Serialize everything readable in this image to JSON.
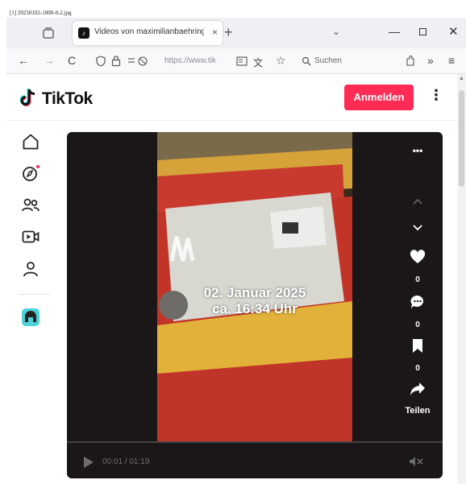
{
  "file_caption": "[1] 20250102-1800-0-2.jpg",
  "browser": {
    "tab": {
      "title": "Videos von maximilianbaehring",
      "close_glyph": "×"
    },
    "new_tab_glyph": "+",
    "list_tabs_glyph": "⌄",
    "window": {
      "minimize_glyph": "—",
      "close_glyph": "✕"
    },
    "nav": {
      "back_glyph": "←",
      "forward_glyph": "→",
      "reload_glyph": "C",
      "url": "https://www.tik",
      "search_placeholder": "Suchen",
      "overflow_glyph": "»",
      "menu_glyph": "≡"
    }
  },
  "tiktok": {
    "logo_text": "TikTok",
    "login_label": "Anmelden",
    "more_glyph": "⋮",
    "sidebar": [
      {
        "icon": "home-icon"
      },
      {
        "icon": "explore-icon"
      },
      {
        "icon": "following-icon"
      },
      {
        "icon": "live-icon"
      },
      {
        "icon": "profile-icon"
      },
      {
        "icon": "app-icon"
      }
    ],
    "video": {
      "overlay_date": "02. Januar 2025",
      "overlay_time": "ca. 16:34 Uhr",
      "more_glyph": "•••",
      "likes": "0",
      "comments": "0",
      "saves": "0",
      "share_label": "Teilen",
      "time": "00:01 / 01:19"
    },
    "colors": {
      "brand": "#fe2c55",
      "accent_dot": "#fe2c55"
    }
  }
}
